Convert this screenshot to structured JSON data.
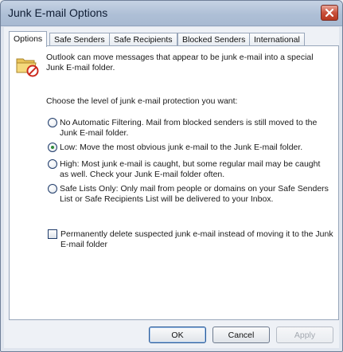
{
  "window": {
    "title": "Junk E-mail Options"
  },
  "tabs": [
    {
      "label": "Options",
      "active": true
    },
    {
      "label": "Safe Senders",
      "active": false
    },
    {
      "label": "Safe Recipients",
      "active": false
    },
    {
      "label": "Blocked Senders",
      "active": false
    },
    {
      "label": "International",
      "active": false
    }
  ],
  "options": {
    "intro": "Outlook can move messages that appear to be junk e-mail into a special Junk E-mail folder.",
    "prompt": "Choose the level of junk e-mail protection you want:",
    "levels": [
      {
        "label": "No Automatic Filtering.  Mail from blocked senders is still moved to the Junk E-mail folder.",
        "selected": false
      },
      {
        "label": "Low: Move the most obvious junk e-mail to the Junk E-mail folder.",
        "selected": true
      },
      {
        "label": "High: Most junk e-mail is caught, but some regular mail may be caught as well. Check your Junk E-mail folder often.",
        "selected": false
      },
      {
        "label": "Safe Lists Only: Only mail from people or domains on your Safe Senders List or Safe Recipients List will be delivered to your Inbox.",
        "selected": false
      }
    ],
    "delete_checkbox": {
      "label": "Permanently delete suspected junk e-mail instead of moving it to the Junk E-mail folder",
      "checked": false
    }
  },
  "buttons": {
    "ok": "OK",
    "cancel": "Cancel",
    "apply": "Apply"
  },
  "icons": {
    "close": "close-icon",
    "folder": "junk-folder-icon"
  },
  "colors": {
    "selected_radio": "#2f8a3a",
    "close_button": "#c9503b"
  }
}
